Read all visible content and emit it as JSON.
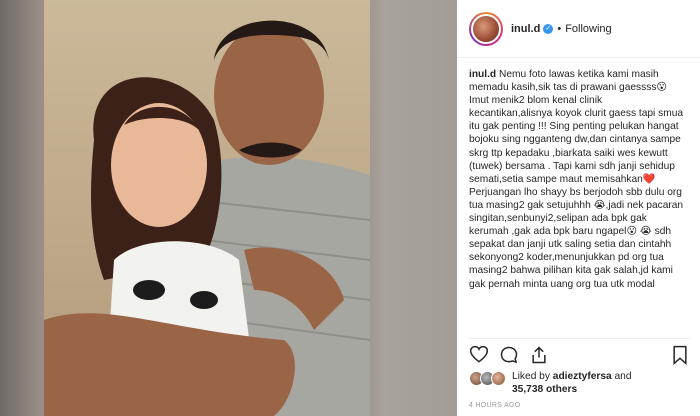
{
  "post": {
    "username": "inul.d",
    "verified_badge": "✓",
    "separator": "•",
    "follow_status": "Following"
  },
  "caption": {
    "username": "inul.d",
    "text": "Nemu foto lawas ketika kami masih memadu kasih,sik tas di prawani gaessss😮 Imut menik2 blom kenal clinik kecantikan,alisnya koyok clurit gaess tapi smua itu gak penting !!! Sing penting pelukan hangat bojoku sing ngganteng dw,dan cintanya sampe skrg ttp kepadaku ,biarkata saiki wes kewutt (tuwek) bersama . Tapi kami sdh janji sehidup semati,setia sampe maut memisahkan❤️ Perjuangan lho shayy bs berjodoh sbb dulu org tua masing2 gak setujuhhh 😭,jadi nek pacaran singitan,senbunyi2,selipan ada bpk gak kerumah ,gak ada bpk baru ngapel😮 😭 sdh sepakat dan janji utk saling setia dan cintahh sekonyong2 koder,menunjukkan pd org tua masing2 bahwa pilihan kita gak salah,jd kami gak pernah minta uang org tua utk modal"
  },
  "actions": {
    "like_icon": "heart-icon",
    "comment_icon": "comment-icon",
    "share_icon": "share-icon",
    "save_icon": "bookmark-icon"
  },
  "likes": {
    "prefix": "Liked by ",
    "user": "adieztyfersa",
    "middle": " and",
    "count": "35,738 others"
  },
  "timestamp": "4 HOURS AGO",
  "colors": {
    "verified": "#3897f0",
    "text": "#262626",
    "muted": "#999999"
  }
}
